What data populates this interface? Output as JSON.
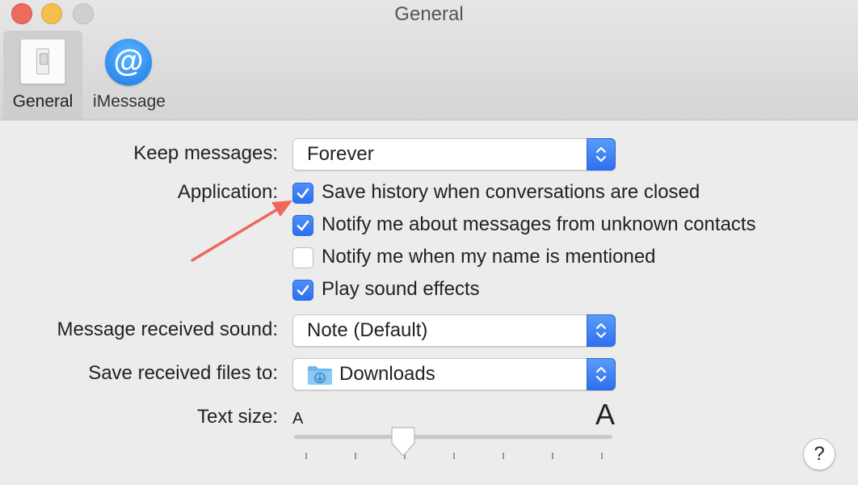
{
  "window": {
    "title": "General"
  },
  "toolbar": {
    "tabs": [
      {
        "label": "General",
        "icon": "light-switch-icon",
        "selected": true
      },
      {
        "label": "iMessage",
        "icon": "at-sign-icon",
        "selected": false
      }
    ]
  },
  "general": {
    "keep_messages": {
      "label": "Keep messages:",
      "value": "Forever"
    },
    "application": {
      "label": "Application:",
      "options": [
        {
          "label": "Save history when conversations are closed",
          "checked": true
        },
        {
          "label": "Notify me about messages from unknown contacts",
          "checked": true
        },
        {
          "label": "Notify me when my name is mentioned",
          "checked": false
        },
        {
          "label": "Play sound effects",
          "checked": true
        }
      ]
    },
    "message_received_sound": {
      "label": "Message received sound:",
      "value": "Note (Default)"
    },
    "save_received_files": {
      "label": "Save received files to:",
      "value": "Downloads",
      "icon": "downloads-folder-icon"
    },
    "text_size": {
      "label": "Text size:",
      "small_glyph": "A",
      "large_glyph": "A",
      "level": 0.33,
      "ticks": 7
    }
  },
  "help": {
    "label": "?"
  },
  "colors": {
    "accent": "#2f6ff0",
    "annotation_arrow": "#f0675a"
  }
}
